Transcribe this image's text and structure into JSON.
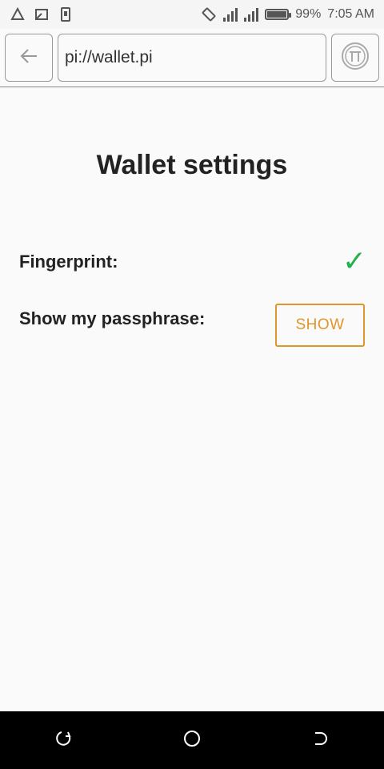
{
  "status_bar": {
    "battery": "99%",
    "time": "7:05 AM",
    "battery_level": 0.99,
    "icons_left": [
      "alert-triangle-icon",
      "screen-cast-icon",
      "phone-icon"
    ],
    "icons_right": [
      "rotate-icon",
      "signal-icon",
      "signal-icon",
      "battery-icon"
    ]
  },
  "browser": {
    "url": "pi://wallet.pi",
    "back_icon": "back-arrow-icon",
    "home_icon": "pi-logo-icon"
  },
  "page": {
    "title": "Wallet settings",
    "fingerprint_label": "Fingerprint:",
    "fingerprint_enabled": true,
    "passphrase_label": "Show my passphrase:",
    "show_button_label": "SHOW"
  },
  "nav_bar": {
    "icons": [
      "recent-apps-icon",
      "home-circle-icon",
      "back-nav-icon"
    ]
  },
  "colors": {
    "accent": "#e0962a",
    "check": "#22b14c",
    "text": "#222222",
    "background": "#fafafa"
  }
}
